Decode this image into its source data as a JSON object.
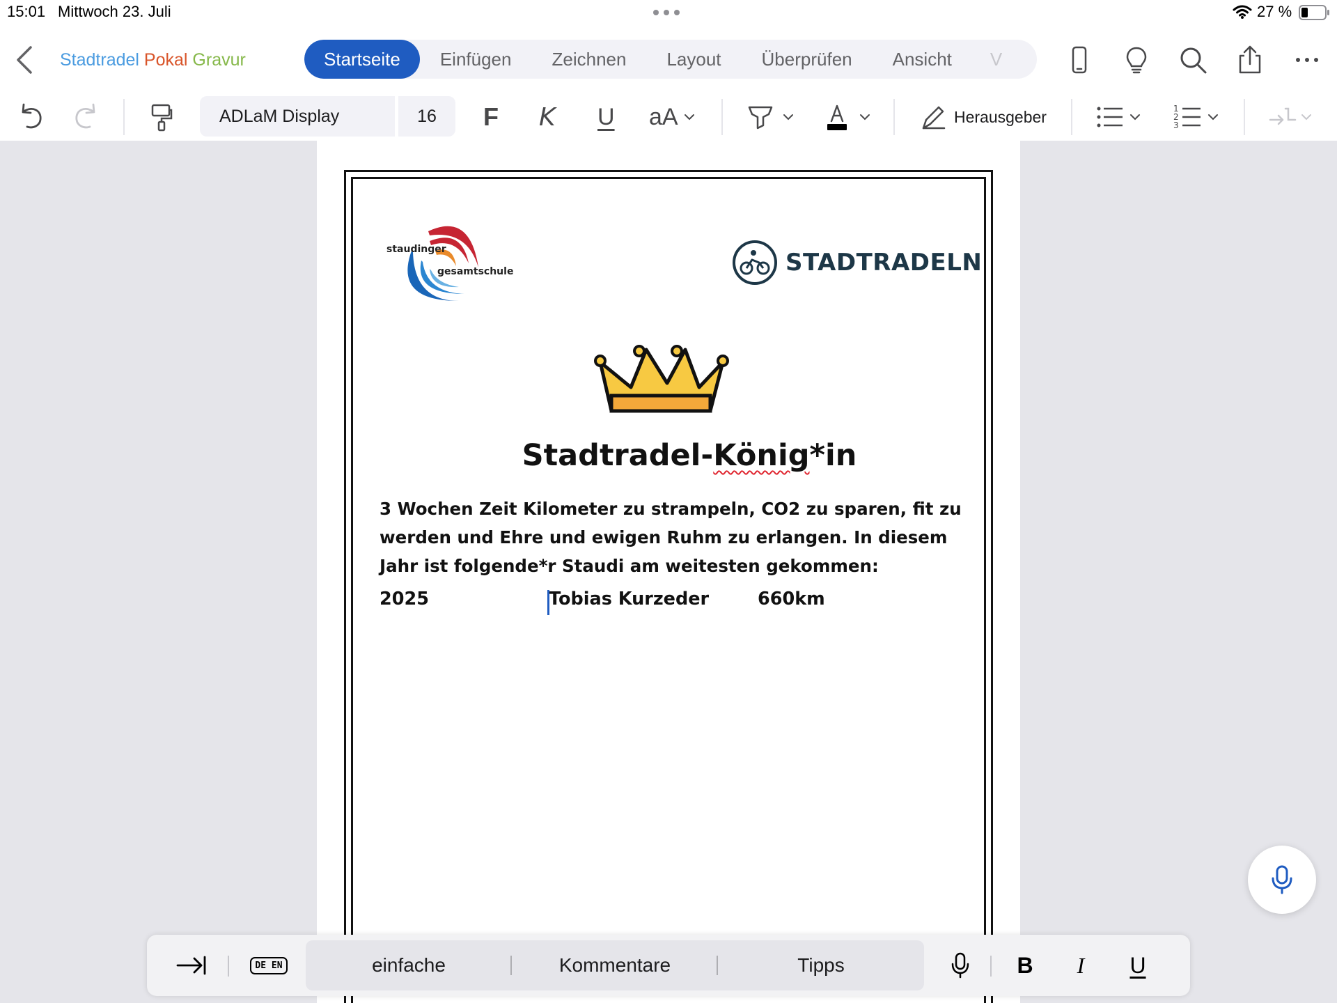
{
  "status_bar": {
    "time": "15:01",
    "date": "Mittwoch 23. Juli",
    "battery": "27 %"
  },
  "app": {
    "doc_title_parts": [
      "Stadtradel",
      "Pokal",
      "Gravur"
    ],
    "tabs": [
      "Startseite",
      "Einfügen",
      "Zeichnen",
      "Layout",
      "Überprüfen",
      "Ansicht",
      "V"
    ],
    "active_tab": "Startseite"
  },
  "ribbon": {
    "font_name": "ADLaM Display",
    "font_size": "16",
    "bold_label": "F",
    "italic_label": "K",
    "underline_label": "U",
    "case_label": "aA",
    "editor_label": "Herausgeber"
  },
  "document": {
    "logo_left_line1": "staudinger",
    "logo_left_line2": "gesamtschule",
    "logo_right": "STADTRADELN",
    "heading_prefix": "Stadtradel-",
    "heading_squiggle": "König",
    "heading_suffix": "*in",
    "paragraph": "3 Wochen Zeit Kilometer zu strampeln, CO2 zu sparen, fit zu werden und Ehre und ewigen Ruhm zu erlangen. In diesem Jahr ist folgende*r Staudi am weitesten gekommen:",
    "entry": {
      "year": "2025",
      "name": "Tobias Kurzeder",
      "distance": "660km"
    }
  },
  "keyboard_bar": {
    "lang_label": "DE EN",
    "suggestions": [
      "einfache",
      "Kommentare",
      "Tipps"
    ],
    "bold": "B",
    "italic": "I",
    "underline": "U"
  },
  "colors": {
    "accent": "#1f5cc1",
    "spell_error": "#e0252f"
  }
}
